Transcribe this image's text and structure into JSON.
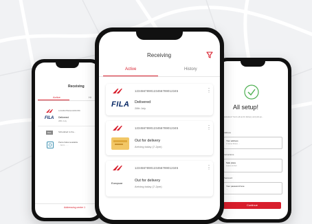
{
  "colors": {
    "brand_red": "#d81e2c",
    "background": "#f1f2f4"
  },
  "center_phone": {
    "title": "Receiving",
    "filter_icon": "filter-icon",
    "tabs": [
      {
        "label": "Active",
        "selected": true
      },
      {
        "label": "History",
        "selected": false
      }
    ],
    "shipments": [
      {
        "carrier_logo": "dhl-express-logo",
        "tracking": "1234567890123456789012345",
        "merchant_logo": "FILA",
        "status": "Delivered",
        "detail": "28th July"
      },
      {
        "carrier_logo": "dhl-express-logo",
        "tracking": "1234567890123456789012345",
        "merchant_logo": "package-image",
        "status": "Out for delivery",
        "detail": "Arriving today (7-2pm)"
      },
      {
        "carrier_logo": "dhl-express-logo",
        "tracking": "1234567890123456789012345",
        "merchant_logo": "Europcar",
        "status": "Out for delivery",
        "detail": "Arriving today (7-2pm)"
      }
    ],
    "more_icon": "more-vertical-icon"
  },
  "left_phone": {
    "title": "Receiving",
    "tabs": [
      {
        "label": "Active"
      },
      {
        "label": "Hi"
      }
    ],
    "rows": [
      {
        "tracking": "1234567890123456789",
        "merchant_logo": "FILA",
        "status": "Delivered",
        "detail": "28th July"
      },
      {
        "badge": "DHL",
        "status": "Scheduled to the...",
        "detail": ""
      },
      {
        "status": "Parcel label available",
        "detail": "... items ... ..."
      }
    ],
    "footer": "Addressing center 1"
  },
  "right_phone": {
    "check_icon": "check-circle-icon",
    "heading": "All setup!",
    "intro": "Congratulations! You're all set for delivery and pick-up...",
    "fields": [
      {
        "label": "Address",
        "value": "Your address",
        "hint": "1 Some Street, ..."
      },
      {
        "label": "Instructions",
        "value": "Safe place",
        "hint": "Leave at door"
      },
      {
        "label": "Password",
        "value": "Your password here",
        "hint": "...."
      }
    ],
    "button": "Continue"
  }
}
